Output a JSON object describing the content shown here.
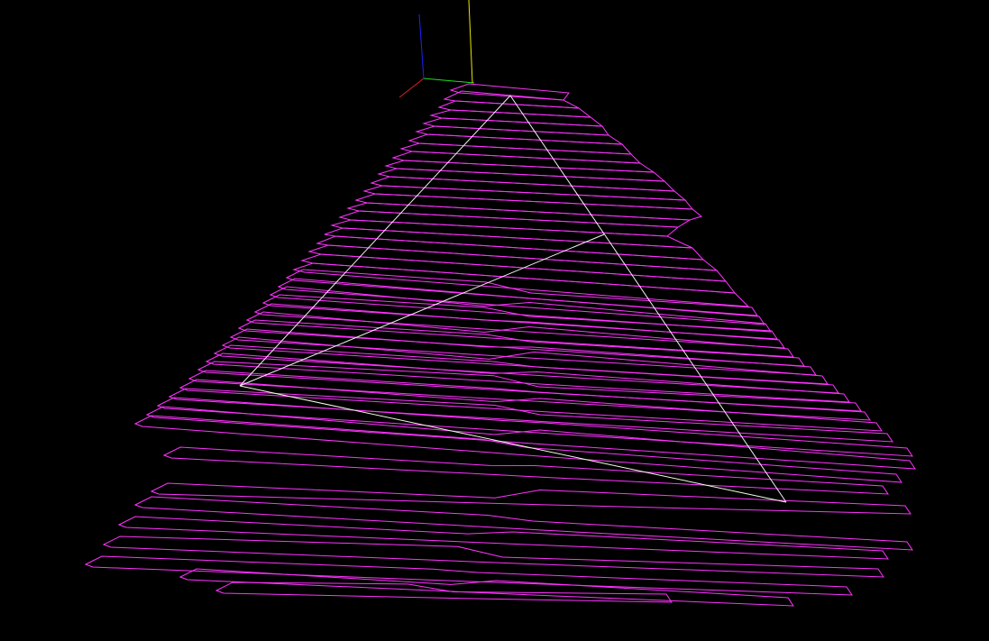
{
  "scene": {
    "background_color": "#000000",
    "slice_color": "#ff33ff",
    "triangle_color": "#f2f2f2",
    "triangle_edge_colors": [
      "#f2f2f2",
      "#f2f2f2",
      "#f0ffe0"
    ]
  },
  "axes_gizmo": {
    "axes": [
      {
        "name": "x-axis",
        "color": "#e02020"
      },
      {
        "name": "y-axis",
        "color": "#20e020"
      },
      {
        "name": "z-axis",
        "color": "#2020ff"
      },
      {
        "name": "vertical-axis",
        "color": "#e8e800"
      }
    ]
  }
}
